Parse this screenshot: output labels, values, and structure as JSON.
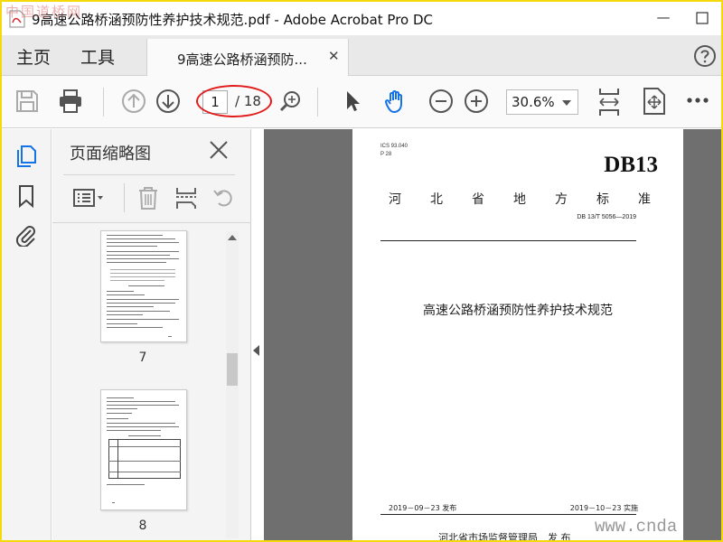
{
  "window": {
    "title": "9高速公路桥涵预防性养护技术规范.pdf - Adobe Acrobat Pro DC",
    "minimize": "—",
    "close": "✕"
  },
  "menu": {
    "home": "主页",
    "tools": "工具",
    "doc_tab": "9高速公路桥涵预防...",
    "doc_tab_close": "✕"
  },
  "toolbar": {
    "page_current": "1",
    "page_total": "/ 18",
    "zoom": "30.6%"
  },
  "thumbnail_panel": {
    "title": "页面缩略图",
    "thumbnails": [
      {
        "page": "7"
      },
      {
        "page": "8"
      }
    ]
  },
  "document": {
    "ics": "ICS 93.040",
    "p_code": "P 28",
    "standard": "DB13",
    "province_std": [
      "河",
      "北",
      "省",
      "地",
      "方",
      "标",
      "准"
    ],
    "number": "DB 13/T 5056—2019",
    "title": "高速公路桥涵预防性养护技术规范",
    "issued": "2019－09－23 发布",
    "effective": "2019－10－23 实施",
    "issuer": "河北省市场监督管理局　发 布"
  },
  "watermarks": {
    "top_left": "中国道桥网",
    "bottom_right": "www.cnda"
  },
  "colors": {
    "accent_blue": "#1473e6",
    "highlight_red": "#e21b1b",
    "frame_yellow": "#f5d90a"
  }
}
